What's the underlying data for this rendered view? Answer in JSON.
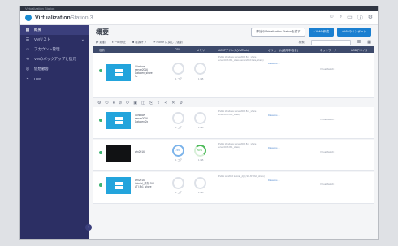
{
  "app": {
    "window_title": "Virtualization Station",
    "title_main": "Virtualization",
    "title_light": "Station 3",
    "top_icons": [
      "user-icon",
      "bell-icon",
      "monitor-icon",
      "info-icon",
      "settings-icon"
    ]
  },
  "sidebar": {
    "items": [
      {
        "label": "概要",
        "icon": "grid-icon",
        "active": true
      },
      {
        "label": "VMリスト",
        "icon": "list-icon",
        "chevron": "⌄"
      },
      {
        "label": "アカウント管理",
        "icon": "user-icon"
      },
      {
        "label": "VMのバックアップと復元",
        "icon": "backup-icon"
      },
      {
        "label": "仮想顧客",
        "icon": "globe-icon"
      },
      {
        "label": "USP",
        "icon": "usb-icon"
      }
    ]
  },
  "header": {
    "title": "概要",
    "buttons": [
      {
        "label": "弊社のVirtualization Stationを試す",
        "primary": false
      },
      {
        "label": "+ VMの作成",
        "primary": true
      },
      {
        "label": "+ VMのインポート",
        "primary": true
      }
    ]
  },
  "toolbar": {
    "actions": [
      "▶ 起動",
      "⏸ 一時停止",
      "■ 電源オフ",
      "⟳ Home に戻して強制"
    ],
    "search_label": "検索"
  },
  "table": {
    "columns": [
      "名前",
      "CPU",
      "メモリ",
      "NIC IPアドレス(VMTools)",
      "ボリューム(使用中/合計)",
      "ネットワーク",
      "USBデバイス"
    ]
  },
  "vms": [
    {
      "name": "Windows server2016 Datacen_share 9x",
      "thumb": "windows",
      "cpu": "",
      "mem": "",
      "cpu_label": "1 コア",
      "mem_label": "1 GB",
      "ip": "(Public Windows server2016 8x1_share server2016 8x1_share server2016 Data_share)",
      "vol": "Datastore ...",
      "net": "Virtual Switch 1"
    },
    {
      "name": "Windows server2016 Datacen 2x",
      "thumb": "windows",
      "cpu": "",
      "mem": "",
      "cpu_label": "1 コア",
      "mem_label": "1 GB",
      "ip": "(Public Windows server2016 8x1_share server2016 8x1_share)",
      "vol": "Datastore ...",
      "net": "Virtual Switch 1"
    },
    {
      "name": "win2016",
      "thumb": "dark",
      "cpu": "1.5%",
      "mem": "50%",
      "cpu_label": "1 コア",
      "mem_label": "1 GB",
      "ip": "(Public Windows server2016 8x1_share server2016 8x1_share)",
      "vol": "Datastore ...",
      "net": "Virtual Switch 1"
    },
    {
      "name": "win2016-tutorial_共有 SK ATI 8x1_share",
      "thumb": "windows",
      "cpu": "",
      "mem": "",
      "cpu_label": "1 コア",
      "mem_label": "1 GB",
      "ip": "(Public win2016 tutorial_共有 SK ATI 8x1_share)",
      "vol": "Datastore ...",
      "net": "Virtual Switch 1"
    }
  ],
  "iconbar": {
    "icons": [
      "gear-icon",
      "power-icon",
      "pause-icon",
      "stop-icon",
      "restart-icon",
      "console-icon",
      "snapshot-icon",
      "copy-icon",
      "export-icon",
      "share-icon",
      "delete-icon",
      "settings-icon"
    ]
  }
}
